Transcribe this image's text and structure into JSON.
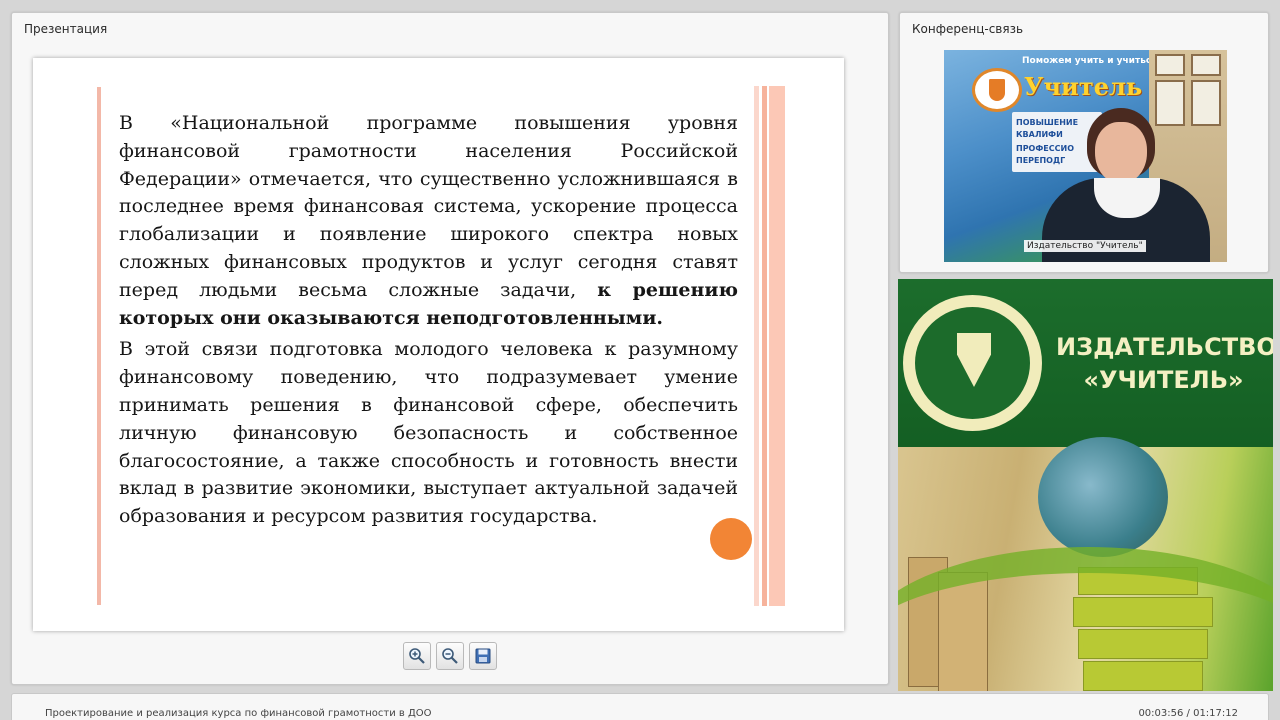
{
  "presentation": {
    "panel_title": "Презентация",
    "slide": {
      "paragraph1_text": "В «Национальной программе повышения уровня финансовой грамотности населения Российской Федерации» отмечается, что существенно усложнившаяся в последнее время финансовая система, ускорение процесса глобализации и появление широкого спектра новых сложных финансовых продуктов и услуг сегодня ставят перед людьми весьма сложные задачи,",
      "paragraph1_bold": "к решению которых они оказываются неподготовленными.",
      "paragraph2_text": "В этой связи подготовка молодого человека к разумному финансовому поведению, что подразумевает умение принимать решения в финансовой сфере, обеспечить личную финансовую безопасность и собственное благосостояние, а также способность и готовность внести вклад в развитие экономики, выступает актуальной задачей образования и ресурсом развития государства."
    },
    "toolbar": {
      "zoom_in_icon": "zoom-in-icon",
      "zoom_out_icon": "zoom-out-icon",
      "save_icon": "save-icon"
    }
  },
  "conference": {
    "panel_title": "Конференц-связь",
    "video": {
      "participant_label": "Издательство \"Учитель\"",
      "background_brand": "Учитель",
      "background_slogan": "Поможем учить и учиться",
      "background_items": [
        "ПОВЫШЕНИЕ",
        "КВАЛИФИ",
        "ПРОФЕССИО",
        "ПЕРЕПОДГ"
      ]
    }
  },
  "publisher": {
    "title_line1": "ИЗДАТЕЛЬСТВО",
    "title_line2": "«УЧИТЕЛЬ»"
  },
  "footer": {
    "course_title": "Проектирование и реализация курса по финансовой грамотности в ДОО",
    "time": "00:03:56 / 01:17:12"
  },
  "colors": {
    "accent_orange": "#f28535",
    "publisher_green": "#1c6d2c",
    "slide_stripe": "#f6b39c"
  }
}
